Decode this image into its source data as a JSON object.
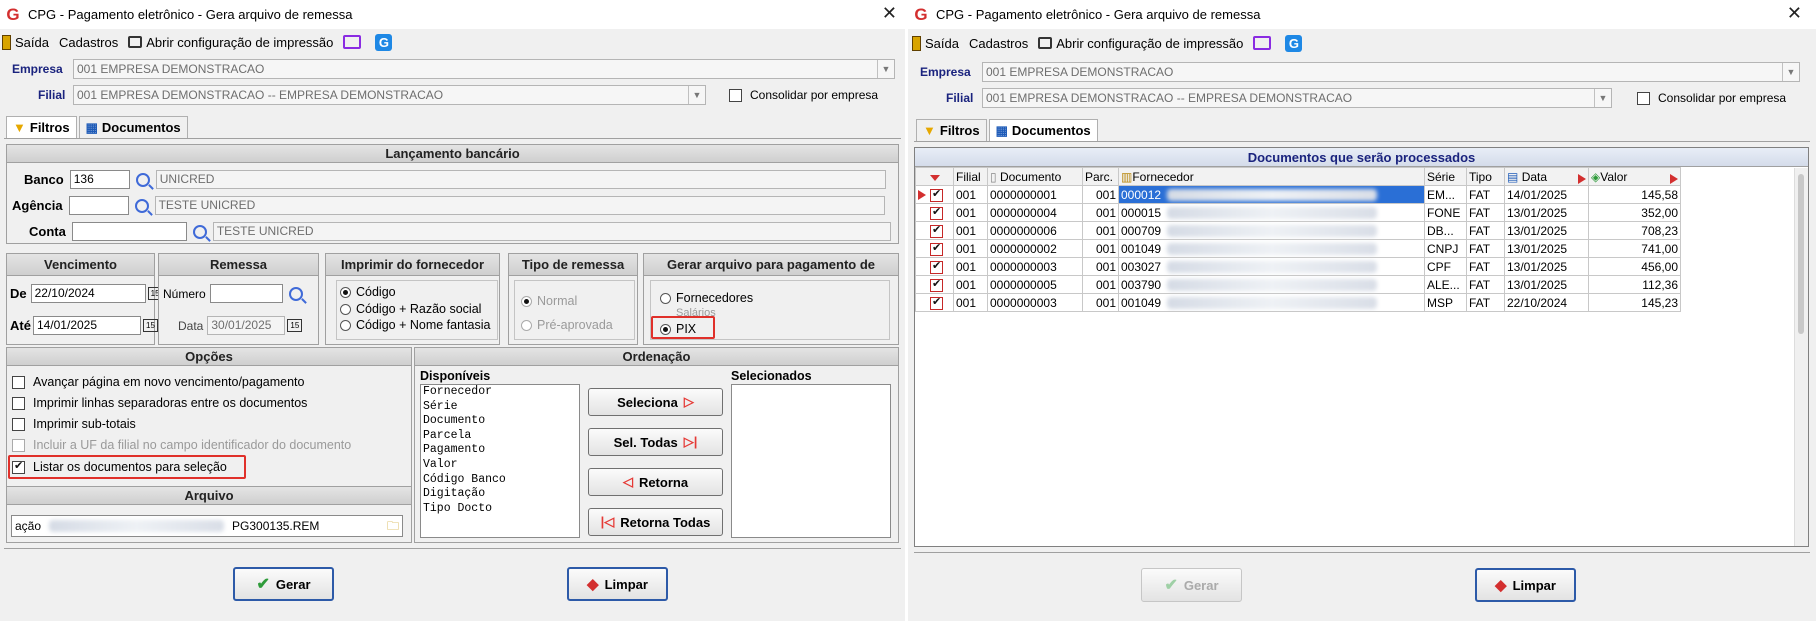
{
  "title": "CPG -  Pagamento eletrônico - Gera arquivo de remessa",
  "toolbar": {
    "exit": "Saída",
    "cadastros": "Cadastros",
    "print_config": "Abrir configuração de impressão"
  },
  "empresa": {
    "label": "Empresa",
    "value": "001 EMPRESA DEMONSTRACAO"
  },
  "filial": {
    "label": "Filial",
    "value": "001 EMPRESA DEMONSTRACAO -- EMPRESA DEMONSTRACAO"
  },
  "consolidar": "Consolidar por empresa",
  "tabs": {
    "filtros": "Filtros",
    "documentos": "Documentos"
  },
  "lancamento": {
    "title": "Lançamento bancário",
    "banco_label": "Banco",
    "banco_code": "136",
    "banco_name": "UNICRED",
    "agencia_label": "Agência",
    "agencia_name": "TESTE UNICRED",
    "conta_label": "Conta",
    "conta_name": "TESTE UNICRED"
  },
  "vencimento": {
    "title": "Vencimento",
    "de_label": "De",
    "de": "22/10/2024",
    "ate_label": "Até",
    "ate": "14/01/2025"
  },
  "remessa": {
    "title": "Remessa",
    "numero_label": "Número",
    "data_label": "Data",
    "data": "30/01/2025"
  },
  "imprimir": {
    "title": "Imprimir do fornecedor",
    "options": [
      "Código",
      "Código + Razão social",
      "Código + Nome fantasia"
    ]
  },
  "tipo": {
    "title": "Tipo de remessa",
    "options": [
      "Normal",
      "Pré-aprovada"
    ]
  },
  "gerar_para": {
    "title": "Gerar arquivo para pagamento de",
    "options": [
      "Fornecedores",
      "Salários",
      "PIX"
    ]
  },
  "opcoes": {
    "title": "Opções",
    "items": [
      "Avançar página em novo vencimento/pagamento",
      "Imprimir linhas separadoras entre os documentos",
      "Imprimir sub-totais",
      "Incluir a UF da filial no campo identificador do documento",
      "Listar os documentos para seleção"
    ]
  },
  "arquivo": {
    "title": "Arquivo",
    "prefix": "ação",
    "suffix": "PG300135.REM"
  },
  "ordenacao": {
    "title": "Ordenação",
    "disponiveis_label": "Disponíveis",
    "selecionados_label": "Selecionados",
    "disponiveis": [
      "Fornecedor",
      "Série",
      "Documento",
      "Parcela",
      "Pagamento",
      "Valor",
      "Código Banco",
      "Digitação",
      "Tipo Docto"
    ],
    "btn_seleciona": "Seleciona",
    "btn_sel_todas": "Sel. Todas",
    "btn_retorna": "Retorna",
    "btn_retorna_todas": "Retorna Todas"
  },
  "buttons": {
    "gerar": "Gerar",
    "limpar": "Limpar"
  },
  "documentos": {
    "title": "Documentos que serão processados",
    "columns": [
      "Filial",
      "Documento",
      "Parc.",
      "Fornecedor",
      "Série",
      "Tipo",
      "Data",
      "Valor"
    ],
    "rows": [
      {
        "filial": "001",
        "doc": "0000000001",
        "parc": "001",
        "forn": "000012",
        "serie": "EM...",
        "tipo": "FAT",
        "data": "14/01/2025",
        "valor": "145,58"
      },
      {
        "filial": "001",
        "doc": "0000000004",
        "parc": "001",
        "forn": "000015",
        "serie": "FONE",
        "tipo": "FAT",
        "data": "13/01/2025",
        "valor": "352,00"
      },
      {
        "filial": "001",
        "doc": "0000000006",
        "parc": "001",
        "forn": "000709",
        "serie": "DB...",
        "tipo": "FAT",
        "data": "13/01/2025",
        "valor": "708,23"
      },
      {
        "filial": "001",
        "doc": "0000000002",
        "parc": "001",
        "forn": "001049",
        "serie": "CNPJ",
        "tipo": "FAT",
        "data": "13/01/2025",
        "valor": "741,00"
      },
      {
        "filial": "001",
        "doc": "0000000003",
        "parc": "001",
        "forn": "003027",
        "serie": "CPF",
        "tipo": "FAT",
        "data": "13/01/2025",
        "valor": "456,00"
      },
      {
        "filial": "001",
        "doc": "0000000005",
        "parc": "001",
        "forn": "003790",
        "serie": "ALE...",
        "tipo": "FAT",
        "data": "13/01/2025",
        "valor": "112,36"
      },
      {
        "filial": "001",
        "doc": "0000000003",
        "parc": "001",
        "forn": "001049",
        "serie": "MSP",
        "tipo": "FAT",
        "data": "22/10/2024",
        "valor": "145,23"
      }
    ]
  }
}
